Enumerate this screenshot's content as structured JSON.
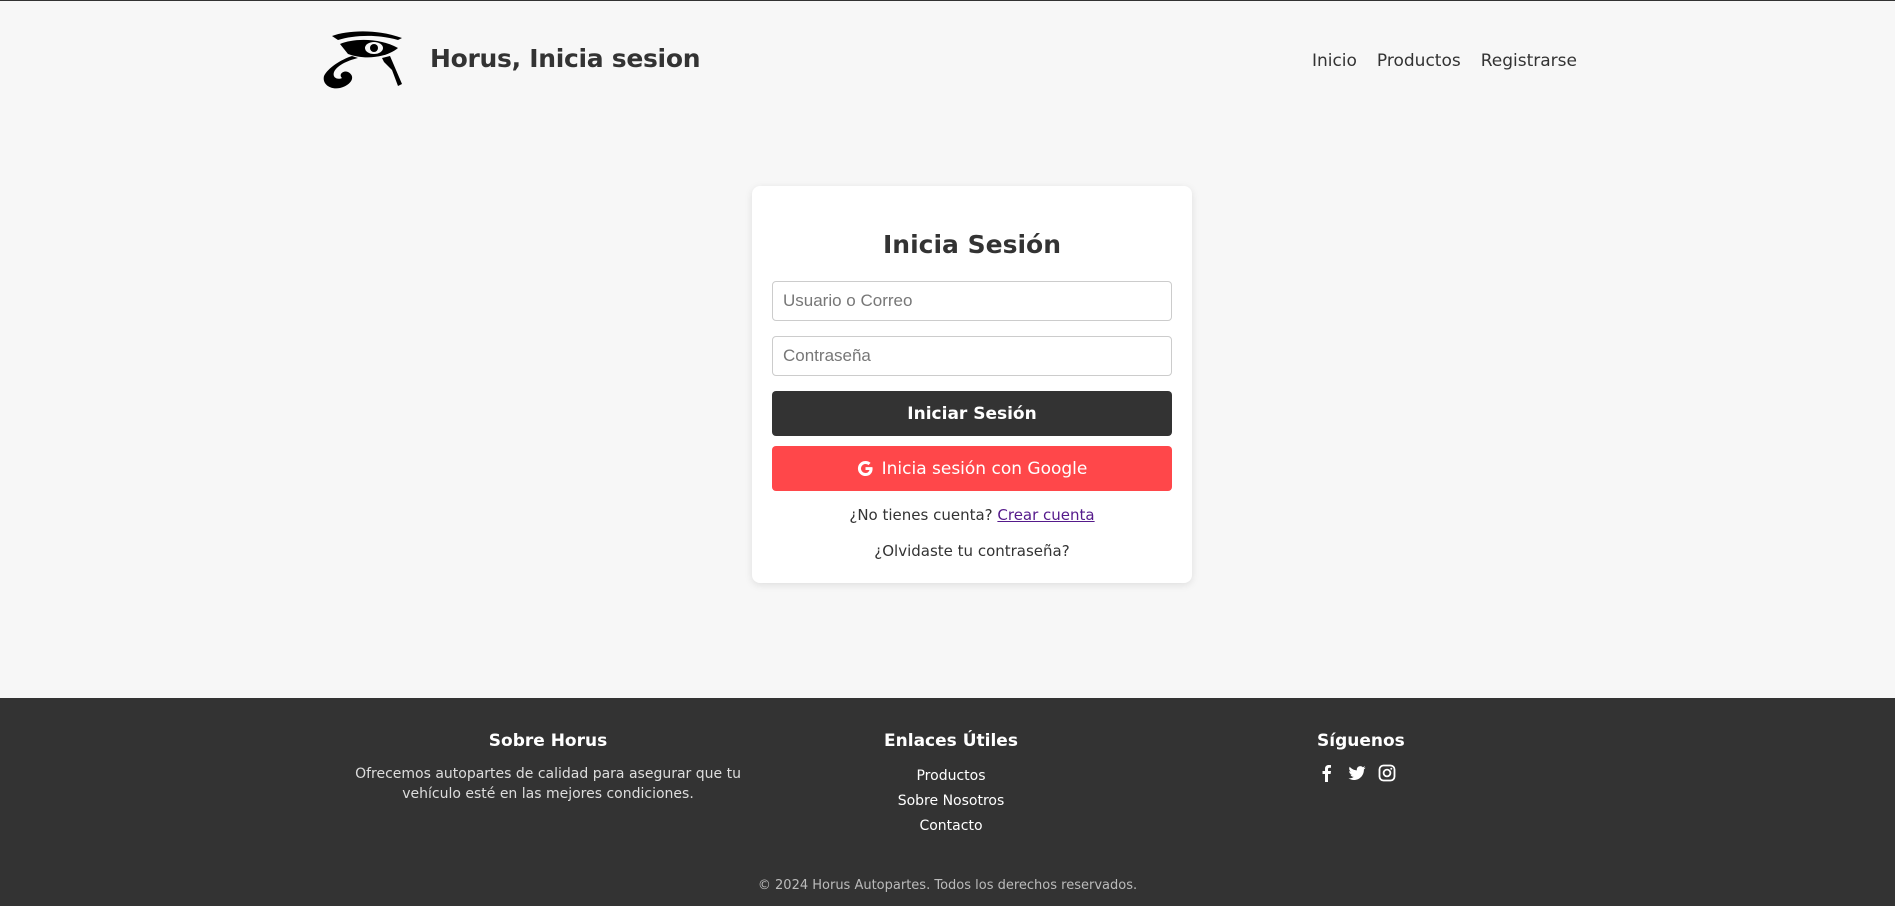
{
  "header": {
    "site_title": "Horus, Inicia sesion",
    "nav": [
      "Inicio",
      "Productos",
      "Registrarse"
    ]
  },
  "login": {
    "title": "Inicia Sesión",
    "username_placeholder": "Usuario o Correo",
    "password_placeholder": "Contraseña",
    "submit_label": "Iniciar Sesión",
    "google_label": "Inicia sesión con Google",
    "no_account_text": "¿No tienes cuenta?",
    "create_account_link": "Crear cuenta",
    "forgot_password": "¿Olvidaste tu contraseña?"
  },
  "footer": {
    "about": {
      "title": "Sobre Horus",
      "text": "Ofrecemos autopartes de calidad para asegurar que tu vehículo esté en las mejores condiciones."
    },
    "links": {
      "title": "Enlaces Útiles",
      "items": [
        "Productos",
        "Sobre Nosotros",
        "Contacto"
      ]
    },
    "social": {
      "title": "Síguenos",
      "icons": [
        "facebook-icon",
        "twitter-icon",
        "instagram-icon"
      ]
    },
    "copyright": "© 2024 Horus Autopartes. Todos los derechos reservados."
  },
  "colors": {
    "page_bg": "#f7f7f7",
    "dark": "#333333",
    "google_red": "#ff474a",
    "link_visited": "#551a8b"
  }
}
